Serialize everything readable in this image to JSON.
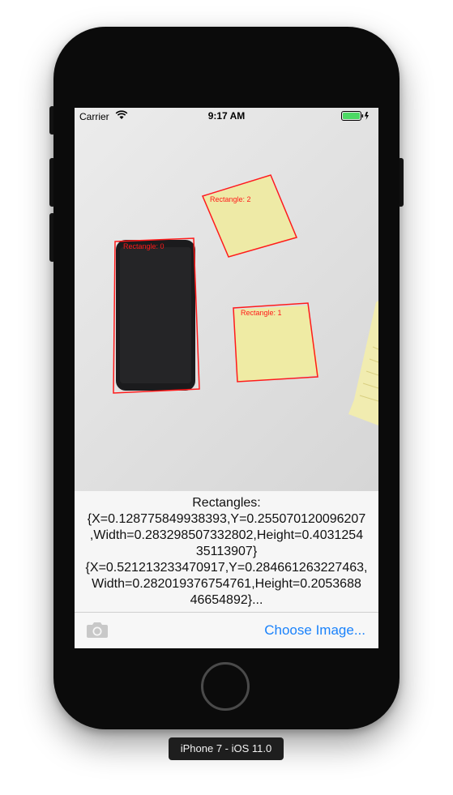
{
  "status_bar": {
    "carrier": "Carrier",
    "time": "9:17 AM",
    "wifi_icon": "wifi-icon",
    "battery_icon": "battery-icon"
  },
  "photo": {
    "labels": [
      "Rectangle: 2",
      "Rectangle: 0",
      "Rectangle: 1"
    ],
    "box_color": "#ff1a1a"
  },
  "results": {
    "heading": "Rectangles:",
    "lines": [
      "{X=0.128775849938393,Y=0.255070120096207",
      ",Width=0.283298507332802,Height=0.4031254",
      "35113907}",
      "{X=0.521213233470917,Y=0.284661263227463,",
      "Width=0.282019376754761,Height=0.2053688",
      "46654892}..."
    ]
  },
  "toolbar": {
    "camera_icon": "camera-icon",
    "choose_label": "Choose Image...",
    "accent": "#1a82fb"
  },
  "device": {
    "label": "iPhone 7 - iOS 11.0"
  }
}
